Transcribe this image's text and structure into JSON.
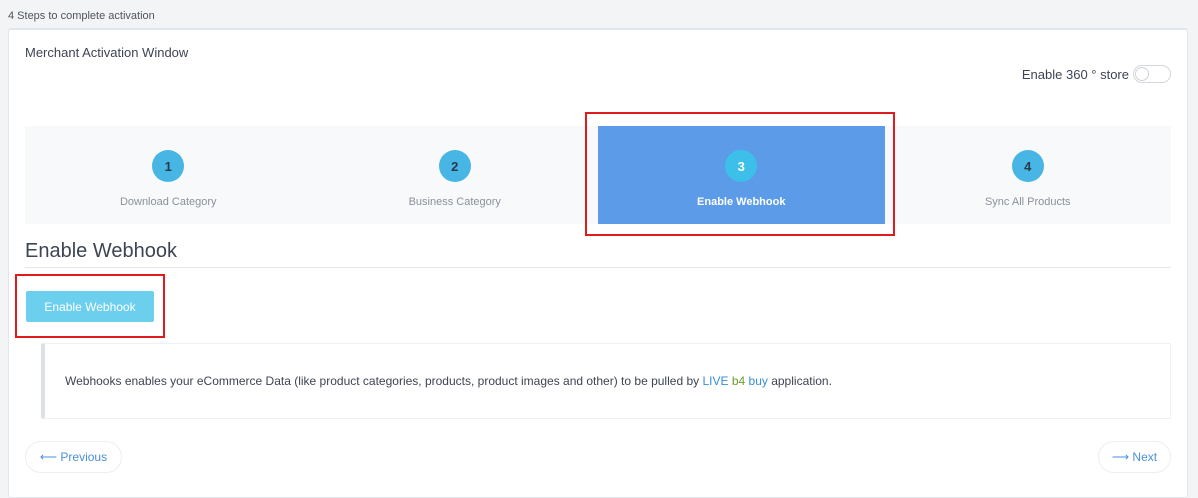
{
  "header": {
    "caption": "4 Steps to complete activation"
  },
  "window": {
    "title": "Merchant Activation Window",
    "toggle_label": "Enable 360 ° store",
    "toggle_on": false
  },
  "steps": [
    {
      "number": "1",
      "label": "Download Category"
    },
    {
      "number": "2",
      "label": "Business Category"
    },
    {
      "number": "3",
      "label": "Enable Webhook"
    },
    {
      "number": "4",
      "label": "Sync All Products"
    }
  ],
  "active_step": 3,
  "section": {
    "title": "Enable Webhook",
    "button_label": "Enable Webhook"
  },
  "note": {
    "text_before": "Webhooks enables your eCommerce Data (like product categories, products, product images and other) to be pulled by ",
    "live": "LIVE",
    "b4": "b4",
    "buy": "buy",
    "text_after": " application."
  },
  "nav": {
    "previous_label": "⟵ Previous",
    "next_label": "⟶ Next"
  },
  "colors": {
    "active_step_bg": "#5b9be8",
    "step_circle": "#47b6e4",
    "button_bg": "#6dcfee",
    "highlight": "#e01b1b",
    "link": "#3a8ed8",
    "b4": "#6a9a2d"
  }
}
